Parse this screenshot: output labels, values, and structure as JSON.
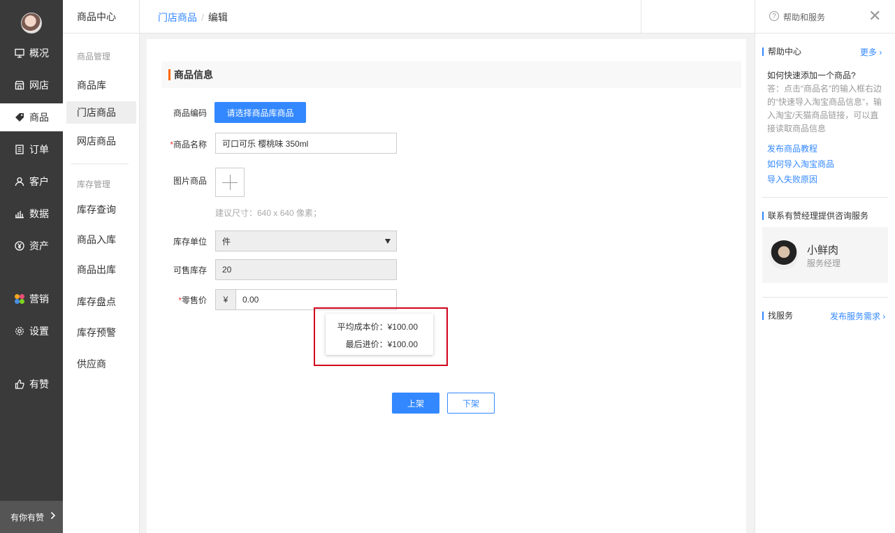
{
  "nav": {
    "items": [
      {
        "label": "概况",
        "icon": "monitor-icon"
      },
      {
        "label": "网店",
        "icon": "store-icon"
      },
      {
        "label": "商品",
        "icon": "tag-icon"
      },
      {
        "label": "订单",
        "icon": "order-icon"
      },
      {
        "label": "客户",
        "icon": "user-icon"
      },
      {
        "label": "数据",
        "icon": "chart-icon"
      },
      {
        "label": "资产",
        "icon": "yen-icon"
      },
      {
        "label": "营销",
        "icon": "marketing-icon"
      },
      {
        "label": "设置",
        "icon": "gear-icon"
      },
      {
        "label": "有赞",
        "icon": "thumb-up-icon"
      }
    ],
    "bottom_label": "有你有赞"
  },
  "subnav": {
    "title": "商品中心",
    "group1": "商品管理",
    "group1_items": [
      "商品库",
      "门店商品",
      "网店商品"
    ],
    "group2": "库存管理",
    "group2_items": [
      "库存查询",
      "商品入库",
      "商品出库",
      "库存盘点",
      "库存预警",
      "供应商"
    ]
  },
  "breadcrumb": {
    "parent": "门店商品",
    "sep": "/",
    "current": "编辑"
  },
  "form": {
    "section_title": "商品信息",
    "code_label": "商品编码",
    "code_button": "请选择商品库商品",
    "name_label": "商品名称",
    "name_value": "可口可乐 樱桃味  350ml",
    "image_label": "图片商品",
    "image_hint": "建议尺寸：640 x 640 像素；",
    "unit_label": "库存单位",
    "unit_value": "件",
    "stock_label": "可售库存",
    "stock_value": "20",
    "price_label": "零售价",
    "price_prefix": "¥",
    "price_value": "0.00",
    "required_mark": "*",
    "tooltip": {
      "avg_cost": "平均成本价：¥100.00",
      "last_price": "最后进价：¥100.00"
    },
    "publish_button": "上架",
    "unpublish_button": "下架"
  },
  "help": {
    "title": "帮助和服务",
    "help_center": "帮助中心",
    "more": "更多 ›",
    "question": "如何快速添加一个商品?",
    "answer": "答：点击“商品名”的输入框右边的“快速导入淘宝商品信息”，输入淘宝/天猫商品链接，可以直接读取商品信息",
    "links": [
      "发布商品教程",
      "如何导入淘宝商品",
      "导入失败原因"
    ],
    "manager_section": "联系有赞经理提供咨询服务",
    "manager_name": "小鲜肉",
    "manager_role": "服务经理",
    "find_service": "找服务",
    "post_request": "发布服务需求 ›"
  },
  "colors": {
    "accent": "#3388ff",
    "nav_bg": "#3a3a3a",
    "highlight": "#d0021b",
    "section_mark": "#ff6600"
  }
}
